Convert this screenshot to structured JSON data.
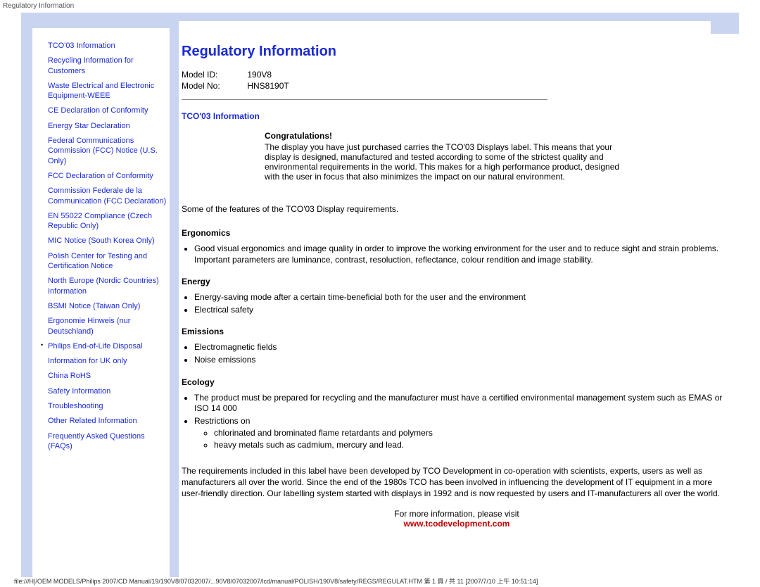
{
  "header_label": "Regulatory Information",
  "page_title": "Regulatory Information",
  "model": {
    "id_label": "Model ID:",
    "id_value": "190V8",
    "no_label": "Model No:",
    "no_value": "HNS8190T"
  },
  "sidebar": {
    "items": [
      {
        "label": "TCO'03 Information"
      },
      {
        "label": "Recycling Information for Customers"
      },
      {
        "label": "Waste Electrical and Electronic Equipment-WEEE"
      },
      {
        "label": "CE Declaration of Conformity"
      },
      {
        "label": "Energy Star Declaration"
      },
      {
        "label": "Federal Communications Commission (FCC) Notice (U.S. Only)"
      },
      {
        "label": "FCC Declaration of Conformity"
      },
      {
        "label": "Commission Federale de la Communication (FCC Declaration)"
      },
      {
        "label": "EN 55022 Compliance (Czech Republic Only)"
      },
      {
        "label": "MIC Notice (South Korea Only)"
      },
      {
        "label": "Polish Center for Testing and Certification Notice"
      },
      {
        "label": "North Europe (Nordic Countries) Information"
      },
      {
        "label": "BSMI Notice (Taiwan Only)"
      },
      {
        "label": "Ergonomie Hinweis (nur Deutschland)"
      },
      {
        "label": "Philips End-of-Life Disposal",
        "bulleted": true
      },
      {
        "label": "Information for UK only"
      },
      {
        "label": "China RoHS"
      },
      {
        "label": "Safety Information"
      },
      {
        "label": "Troubleshooting"
      },
      {
        "label": "Other Related Information"
      },
      {
        "label": "Frequently Asked Questions (FAQs)"
      }
    ]
  },
  "tco": {
    "section_title": "TCO'03 Information",
    "congrats_title": "Congratulations!",
    "congrats_body": "The display you have just purchased carries the TCO'03 Displays label. This means that your display is designed, manufactured and tested according to some of the strictest quality and environmental requirements in the world. This makes for a high performance product, designed with the user in focus that also minimizes the impact on our natural environment.",
    "features_intro": "Some of the features of the TCO'03 Display requirements.",
    "ergonomics": {
      "title": "Ergonomics",
      "items": [
        "Good visual ergonomics and image quality in order to improve the working environment for the user and to reduce sight and strain problems. Important parameters are luminance, contrast, resoluction, reflectance, colour rendition and image stability."
      ]
    },
    "energy": {
      "title": "Energy",
      "items": [
        "Energy-saving mode after a certain time-beneficial both for the user and the environment",
        "Electrical safety"
      ]
    },
    "emissions": {
      "title": "Emissions",
      "items": [
        "Electromagnetic fields",
        "Noise emissions"
      ]
    },
    "ecology": {
      "title": "Ecology",
      "items": [
        "The product must be prepared for recycling and the manufacturer must have a certified environmental management system such as EMAS or ISO 14 000",
        "Restrictions on"
      ],
      "subitems": [
        "chlorinated and brominated flame retardants and polymers",
        "heavy metals such as cadmium, mercury and lead."
      ]
    },
    "req_para": "The requirements included in this label have been developed by TCO Development in co-operation with scientists, experts, users as well as manufacturers all over the world. Since the end of the 1980s TCO has been involved in influencing the development of IT equipment in a more user-friendly direction. Our labelling system started with displays in 1992 and is now requested by users and IT-manufacturers all over the world.",
    "more_info": "For more information, please visit",
    "tco_url": "www.tcodevelopment.com"
  },
  "footer_path": "file:///H|/OEM MODELS/Philips 2007/CD Manual/19/190V8/07032007/...90V8/07032007/lcd/manual/POLISH/190V8/safety/REGS/REGULAT.HTM 第 1 頁 / 共 11  [2007/7/10 上午 10:51:14]"
}
